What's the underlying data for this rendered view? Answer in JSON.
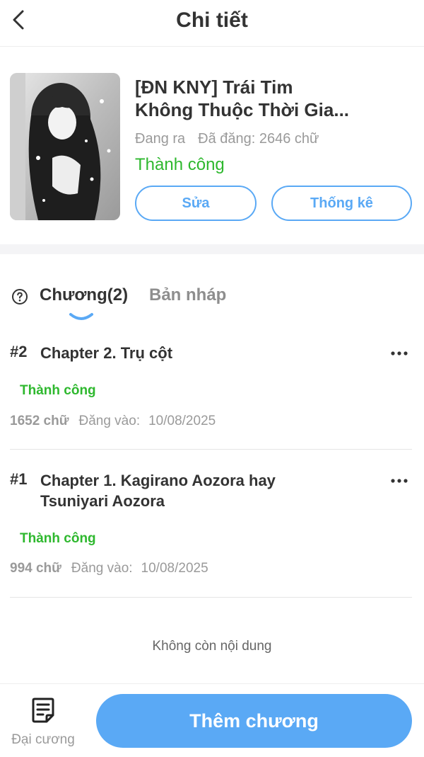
{
  "header": {
    "title": "Chi tiết"
  },
  "book": {
    "title_line1": "[ĐN KNY] Trái Tim",
    "title_line2": "Không Thuộc Thời Gia...",
    "state": "Đang ra",
    "words": "Đã đăng: 2646 chữ",
    "status": "Thành công",
    "edit_label": "Sửa",
    "stats_label": "Thống kê"
  },
  "tabs": {
    "chapters": "Chương(2)",
    "drafts": "Bản nháp"
  },
  "chapters": [
    {
      "number": "#2",
      "title": "Chapter 2. Trụ cột",
      "status": "Thành công",
      "words": "1652 chữ",
      "posted_label": "Đăng vào:",
      "date": "10/08/2025"
    },
    {
      "number": "#1",
      "title": "Chapter 1. Kagirano Aozora hay Tsuniyari Aozora",
      "status": "Thành công",
      "words": "994 chữ",
      "posted_label": "Đăng vào:",
      "date": "10/08/2025"
    }
  ],
  "end_text": "Không còn nội dung",
  "bottom": {
    "outline_label": "Đại cương",
    "add_label": "Thêm chương"
  },
  "colors": {
    "accent": "#5aa9f5",
    "success": "#2eb82e",
    "muted": "#9a9a9a"
  }
}
